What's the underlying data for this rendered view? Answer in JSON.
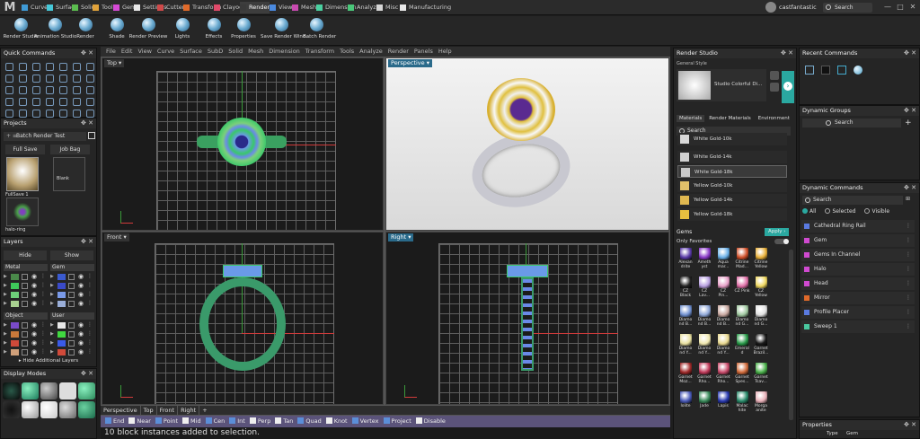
{
  "app": {
    "logo": "M"
  },
  "tabs": [
    {
      "label": "Curve",
      "color": "#3f9ad6"
    },
    {
      "label": "Surface",
      "color": "#46c8d8"
    },
    {
      "label": "Solid",
      "color": "#5bbd4f"
    },
    {
      "label": "Tools",
      "color": "#e0a23a"
    },
    {
      "label": "Gems",
      "color": "#d64ad6"
    },
    {
      "label": "Settings",
      "color": "#e8e8e8"
    },
    {
      "label": "Cutters",
      "color": "#d04a4a"
    },
    {
      "label": "Transform",
      "color": "#e06a2a"
    },
    {
      "label": "Clayoo",
      "color": "#e04a6a"
    },
    {
      "label": "Render",
      "color": "#3a3a3a"
    },
    {
      "label": "View",
      "color": "#4a8ae0"
    },
    {
      "label": "Mesh",
      "color": "#c84ab0"
    },
    {
      "label": "Dimension",
      "color": "#4ad0a0"
    },
    {
      "label": "Analyze",
      "color": "#4ac87a"
    },
    {
      "label": "Misc",
      "color": "#d6d6d6"
    },
    {
      "label": "Manufacturing",
      "color": "#e8e8e8"
    }
  ],
  "user": {
    "name": "castfantastic"
  },
  "global_search": {
    "placeholder": "Search"
  },
  "toolbar": [
    "Render Studio",
    "Animation Studio",
    "Render",
    "Shade",
    "Render Preview",
    "Lights",
    "Effects",
    "Properties",
    "Save Render Wind...",
    "Batch Render"
  ],
  "quick_commands": {
    "title": "Quick Commands"
  },
  "projects": {
    "title": "Projects",
    "selector": "Batch Render Test",
    "buttons": [
      "Full Save",
      "Job Bag"
    ],
    "thumbs": [
      "FullSave 1",
      "Blank",
      "halo-ring"
    ]
  },
  "layers": {
    "title": "Layers",
    "hide": "Hide",
    "show": "Show",
    "metal_header": "Metal",
    "gem_header": "Gem",
    "object_header": "Object",
    "user_header": "User",
    "metal_colors": [
      "#4a8a4a",
      "#3ec85a",
      "#6ed07a",
      "#a8d090"
    ],
    "gem_colors": [
      "#3a5ad0",
      "#3a4ac8",
      "#7a9ae8",
      "#9aaed8"
    ],
    "object_colors": [
      "#7a4ac8",
      "#c8783a",
      "#d04a3a",
      "#d0a07a"
    ],
    "user_colors": [
      "#e8e8e8",
      "#40d840",
      "#3a5ae8",
      "#d04a3a"
    ],
    "additional": "Hide Additional Layers"
  },
  "display_modes": {
    "title": "Display Modes"
  },
  "main_menu": [
    "File",
    "Edit",
    "View",
    "Curve",
    "Surface",
    "SubD",
    "Solid",
    "Mesh",
    "Dimension",
    "Transform",
    "Tools",
    "Analyze",
    "Render",
    "Panels",
    "Help"
  ],
  "viewports": {
    "top": "Top",
    "perspective": "Perspective",
    "front": "Front",
    "right": "Right"
  },
  "viewport_tabs": [
    "Perspective",
    "Top",
    "Front",
    "Right"
  ],
  "osnaps": [
    {
      "label": "End",
      "on": true
    },
    {
      "label": "Near",
      "on": false
    },
    {
      "label": "Point",
      "on": true
    },
    {
      "label": "Mid",
      "on": false
    },
    {
      "label": "Cen",
      "on": true
    },
    {
      "label": "Int",
      "on": true
    },
    {
      "label": "Perp",
      "on": false
    },
    {
      "label": "Tan",
      "on": false
    },
    {
      "label": "Quad",
      "on": true
    },
    {
      "label": "Knot",
      "on": false
    },
    {
      "label": "Vertex",
      "on": true
    },
    {
      "label": "Project",
      "on": true
    },
    {
      "label": "Disable",
      "on": false
    }
  ],
  "command_line": "10 block instances added to selection.",
  "render_studio": {
    "title": "Render Studio",
    "general_style": "General Style",
    "style_name": "Studio Colorful Di...",
    "tabs": [
      "Materials",
      "Render Materials",
      "Environment"
    ],
    "search": "Search",
    "materials": [
      {
        "name": "White Gold-10k",
        "color": "#d8d8d8"
      },
      {
        "name": "White Gold-14k",
        "color": "#d0d0d0"
      },
      {
        "name": "White Gold-18k",
        "color": "#c8c8c8"
      },
      {
        "name": "Yellow Gold-10k",
        "color": "#e0c06a"
      },
      {
        "name": "Yellow Gold-14k",
        "color": "#e0b850"
      },
      {
        "name": "Yellow Gold-18k",
        "color": "#e8c040"
      }
    ],
    "gems_title": "Gems",
    "apply": "Apply",
    "only_favorites": "Only Favorites",
    "gems": [
      {
        "name": "Alexan drite",
        "color": "#5a3aa8"
      },
      {
        "name": "Ameth yst",
        "color": "#8a3ac8"
      },
      {
        "name": "Aqua mar...",
        "color": "#6ab0e8"
      },
      {
        "name": "Citrine Mad...",
        "color": "#d0502a"
      },
      {
        "name": "Citrine Yellow",
        "color": "#e8b03a"
      },
      {
        "name": "CZ Black",
        "color": "#222222"
      },
      {
        "name": "CZ Lav...",
        "color": "#b8a0e0"
      },
      {
        "name": "CZ Pin...",
        "color": "#e8a0c8"
      },
      {
        "name": "CZ Pink",
        "color": "#e070a8"
      },
      {
        "name": "CZ Yellow",
        "color": "#f0d860"
      },
      {
        "name": "Diamo nd B...",
        "color": "#7090d0"
      },
      {
        "name": "Diamo nd B...",
        "color": "#90a8d8"
      },
      {
        "name": "Diamo nd B...",
        "color": "#c8a8a0"
      },
      {
        "name": "Diamo nd G...",
        "color": "#a0c8a0"
      },
      {
        "name": "Diamo nd G...",
        "color": "#e0e0e0"
      },
      {
        "name": "Diamo nd Y...",
        "color": "#e8e0a0"
      },
      {
        "name": "Diamo nd Y...",
        "color": "#f0e8b0"
      },
      {
        "name": "Diamo nd Y...",
        "color": "#e8d890"
      },
      {
        "name": "Emeral d",
        "color": "#2a9a4a"
      },
      {
        "name": "Garnet Brazil...",
        "color": "#1a1a1a"
      },
      {
        "name": "Garnet Moz...",
        "color": "#a02a2a"
      },
      {
        "name": "Garnet Rho...",
        "color": "#c03a5a"
      },
      {
        "name": "Garnet Rho...",
        "color": "#c84a6a"
      },
      {
        "name": "Garnet Spes...",
        "color": "#d06a3a"
      },
      {
        "name": "Garnet Tsav...",
        "color": "#4ab04a"
      },
      {
        "name": "Iolite",
        "color": "#4a5ab8"
      },
      {
        "name": "Jade",
        "color": "#3a8a5a"
      },
      {
        "name": "Lapis",
        "color": "#2a3ab0"
      },
      {
        "name": "Malac hite",
        "color": "#2a8a6a"
      },
      {
        "name": "Morga anite",
        "color": "#e8b0b8"
      }
    ]
  },
  "recent_commands": {
    "title": "Recent Commands"
  },
  "dynamic_groups": {
    "title": "Dynamic Groups",
    "search": "Search"
  },
  "dynamic_commands": {
    "title": "Dynamic Commands",
    "search": "Search",
    "filters": [
      "All",
      "Selected",
      "Visible"
    ],
    "items": [
      {
        "label": "Cathedral Ring Rail",
        "color": "#5a7ae0"
      },
      {
        "label": "Gem",
        "color": "#d04ad0"
      },
      {
        "label": "Gems In Channel",
        "color": "#d04ad0"
      },
      {
        "label": "Halo",
        "color": "#d04ad0"
      },
      {
        "label": "Head",
        "color": "#d04ad0"
      },
      {
        "label": "Mirror",
        "color": "#e06a2a"
      },
      {
        "label": "Profile Placer",
        "color": "#5a7ae0"
      },
      {
        "label": "Sweep 1",
        "color": "#4ac8a0"
      }
    ]
  },
  "properties": {
    "title": "Properties",
    "type_label": "Type",
    "type_value": "Gem"
  }
}
